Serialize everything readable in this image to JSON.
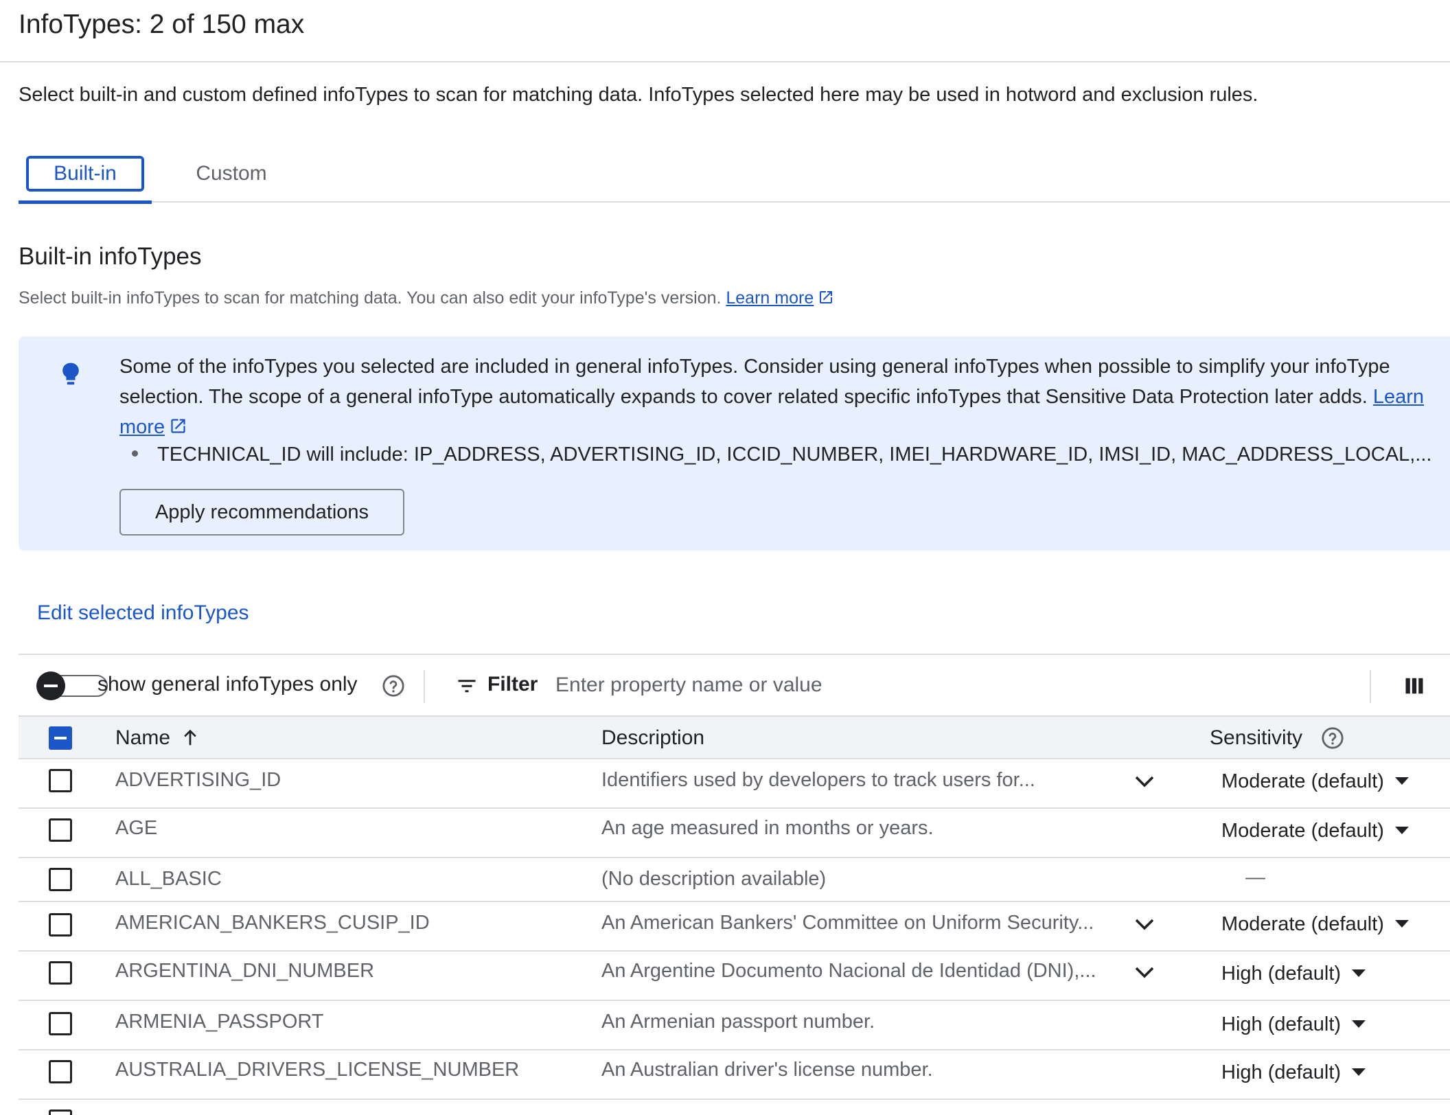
{
  "header": {
    "title": "InfoTypes: 2 of 150 max"
  },
  "intro": "Select built-in and custom defined infoTypes to scan for matching data. InfoTypes selected here may be used in hotword and exclusion rules.",
  "tabs": [
    {
      "label": "Built-in",
      "active": true
    },
    {
      "label": "Custom",
      "active": false
    }
  ],
  "section": {
    "title": "Built-in infoTypes",
    "subtitle": "Select built-in infoTypes to scan for matching data. You can also edit your infoType's version.",
    "learn_more": "Learn more"
  },
  "banner": {
    "icon": "lightbulb-icon",
    "text": "Some of the infoTypes you selected are included in general infoTypes. Consider using general infoTypes when possible to simplify your infoType selection. The scope of a general infoType automatically expands to cover related specific infoTypes that Sensitive Data Protection later adds.",
    "learn_more": "Learn more",
    "bullet": "TECHNICAL_ID will include: IP_ADDRESS, ADVERTISING_ID, ICCID_NUMBER, IMEI_HARDWARE_ID, IMSI_ID, MAC_ADDRESS_LOCAL,...",
    "apply_button": "Apply recommendations"
  },
  "edit_link": "Edit selected infoTypes",
  "toolbar": {
    "toggle_label": "show general infoTypes only",
    "toggle_on": false,
    "filter_label": "Filter",
    "filter_placeholder": "Enter property name or value"
  },
  "table": {
    "columns": {
      "name": "Name",
      "description": "Description",
      "sensitivity": "Sensitivity"
    },
    "sort": "ascending",
    "rows": [
      {
        "name": "ADVERTISING_ID",
        "description": "Identifiers used by developers to track users for...",
        "expandable": true,
        "sensitivity": "Moderate (default)"
      },
      {
        "name": "AGE",
        "description": "An age measured in months or years.",
        "expandable": false,
        "sensitivity": "Moderate (default)"
      },
      {
        "name": "ALL_BASIC",
        "description": "(No description available)",
        "expandable": false,
        "sensitivity": "—"
      },
      {
        "name": "AMERICAN_BANKERS_CUSIP_ID",
        "description": "An American Bankers' Committee on Uniform Security...",
        "expandable": true,
        "sensitivity": "Moderate (default)"
      },
      {
        "name": "ARGENTINA_DNI_NUMBER",
        "description": "An Argentine Documento Nacional de Identidad (DNI),...",
        "expandable": true,
        "sensitivity": "High (default)"
      },
      {
        "name": "ARMENIA_PASSPORT",
        "description": "An Armenian passport number.",
        "expandable": false,
        "sensitivity": "High (default)"
      },
      {
        "name": "AUSTRALIA_DRIVERS_LICENSE_NUMBER",
        "description": "An Australian driver's license number.",
        "expandable": false,
        "sensitivity": "High (default)"
      }
    ]
  },
  "colors": {
    "accent": "#1a56c8",
    "banner_bg": "#e8f0fe",
    "text": "#202124",
    "muted": "#5f6368",
    "divider": "#dadce0"
  }
}
